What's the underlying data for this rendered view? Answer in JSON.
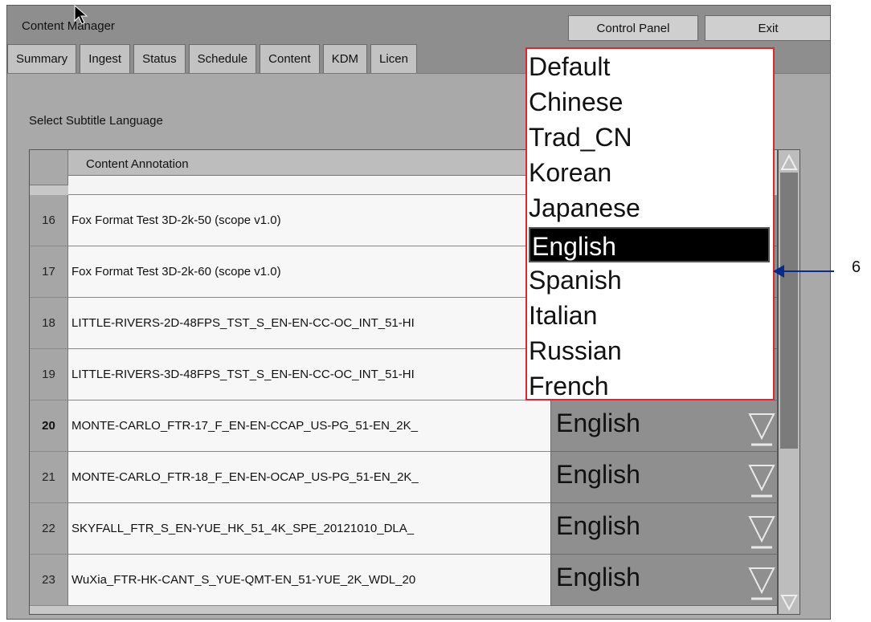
{
  "window": {
    "title": "Content Manager"
  },
  "top_buttons": {
    "control_panel": "Control Panel",
    "exit": "Exit"
  },
  "tabs": [
    "Summary",
    "Ingest",
    "Status",
    "Schedule",
    "Content",
    "KDM",
    "Licen"
  ],
  "prompt": "Select Subtitle Language",
  "table": {
    "header": "Content Annotation",
    "rows": [
      {
        "num": "16",
        "annotation": "Fox Format Test 3D-2k-50 (scope v1.0)",
        "language": ""
      },
      {
        "num": "17",
        "annotation": "Fox Format Test 3D-2k-60 (scope v1.0)",
        "language": ""
      },
      {
        "num": "18",
        "annotation": "LITTLE-RIVERS-2D-48FPS_TST_S_EN-EN-CC-OC_INT_51-HI",
        "language": ""
      },
      {
        "num": "19",
        "annotation": "LITTLE-RIVERS-3D-48FPS_TST_S_EN-EN-CC-OC_INT_51-HI",
        "language": ""
      },
      {
        "num": "20",
        "annotation": "MONTE-CARLO_FTR-17_F_EN-EN-CCAP_US-PG_51-EN_2K_",
        "language": "English"
      },
      {
        "num": "21",
        "annotation": "MONTE-CARLO_FTR-18_F_EN-EN-OCAP_US-PG_51-EN_2K_",
        "language": "English"
      },
      {
        "num": "22",
        "annotation": "SKYFALL_FTR_S_EN-YUE_HK_51_4K_SPE_20121010_DLA_",
        "language": "English"
      },
      {
        "num": "23",
        "annotation": "WuXia_FTR-HK-CANT_S_YUE-QMT-EN_51-YUE_2K_WDL_20",
        "language": "English"
      }
    ]
  },
  "dropdown": {
    "options": [
      "Default",
      "Chinese",
      "Trad_CN",
      "Korean",
      "Japanese",
      "English",
      "Spanish",
      "Italian",
      "Russian",
      "French"
    ],
    "selected": "English"
  },
  "callout": {
    "label": "6",
    "color": "#0a2a8a"
  },
  "colors": {
    "highlight_border": "#e0262a",
    "selected_bg": "#000000"
  },
  "icons": {
    "dropdown_arrow": "chevron-down-icon",
    "cursor": "mouse-pointer-icon"
  }
}
